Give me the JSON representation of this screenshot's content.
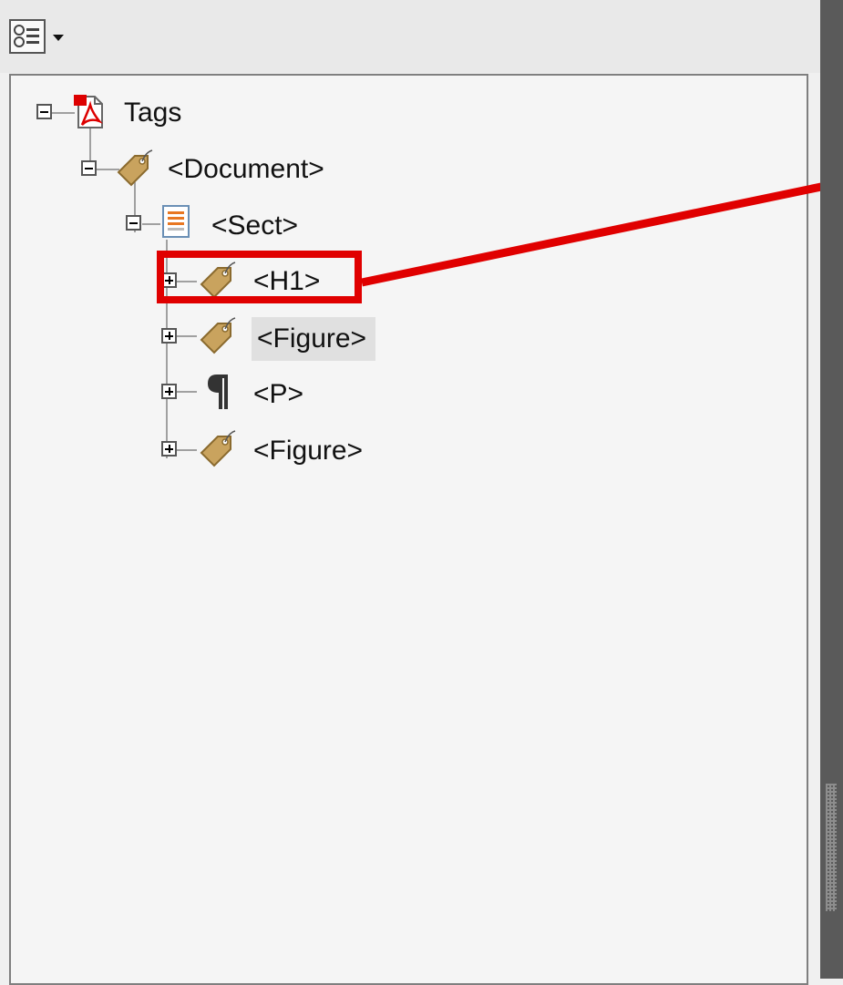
{
  "toolbar": {
    "options_icon": "list-options-icon",
    "dropdown_icon": "triangle-down-icon"
  },
  "tree": {
    "root": {
      "label": "Tags",
      "icon": "pdf-document-icon",
      "expanded": true
    },
    "document": {
      "label": "<Document>",
      "icon": "tag-icon",
      "expanded": true
    },
    "sect": {
      "label": "<Sect>",
      "icon": "section-icon",
      "expanded": true
    },
    "children": [
      {
        "label": "<H1>",
        "icon": "tag-icon",
        "expanded": false,
        "highlighted": true
      },
      {
        "label": "<Figure>",
        "icon": "tag-icon",
        "expanded": false,
        "hovered": true
      },
      {
        "label": "<P>",
        "icon": "paragraph-icon",
        "expanded": false
      },
      {
        "label": "<Figure>",
        "icon": "tag-icon",
        "expanded": false
      }
    ]
  },
  "annotation": {
    "color": "#e00000"
  },
  "colors": {
    "panel_bg": "#f5f5f5",
    "toolbar_bg": "#e9e9e9",
    "scrollbar": "#5a5a5a",
    "tree_lines": "#a0a0a0"
  }
}
